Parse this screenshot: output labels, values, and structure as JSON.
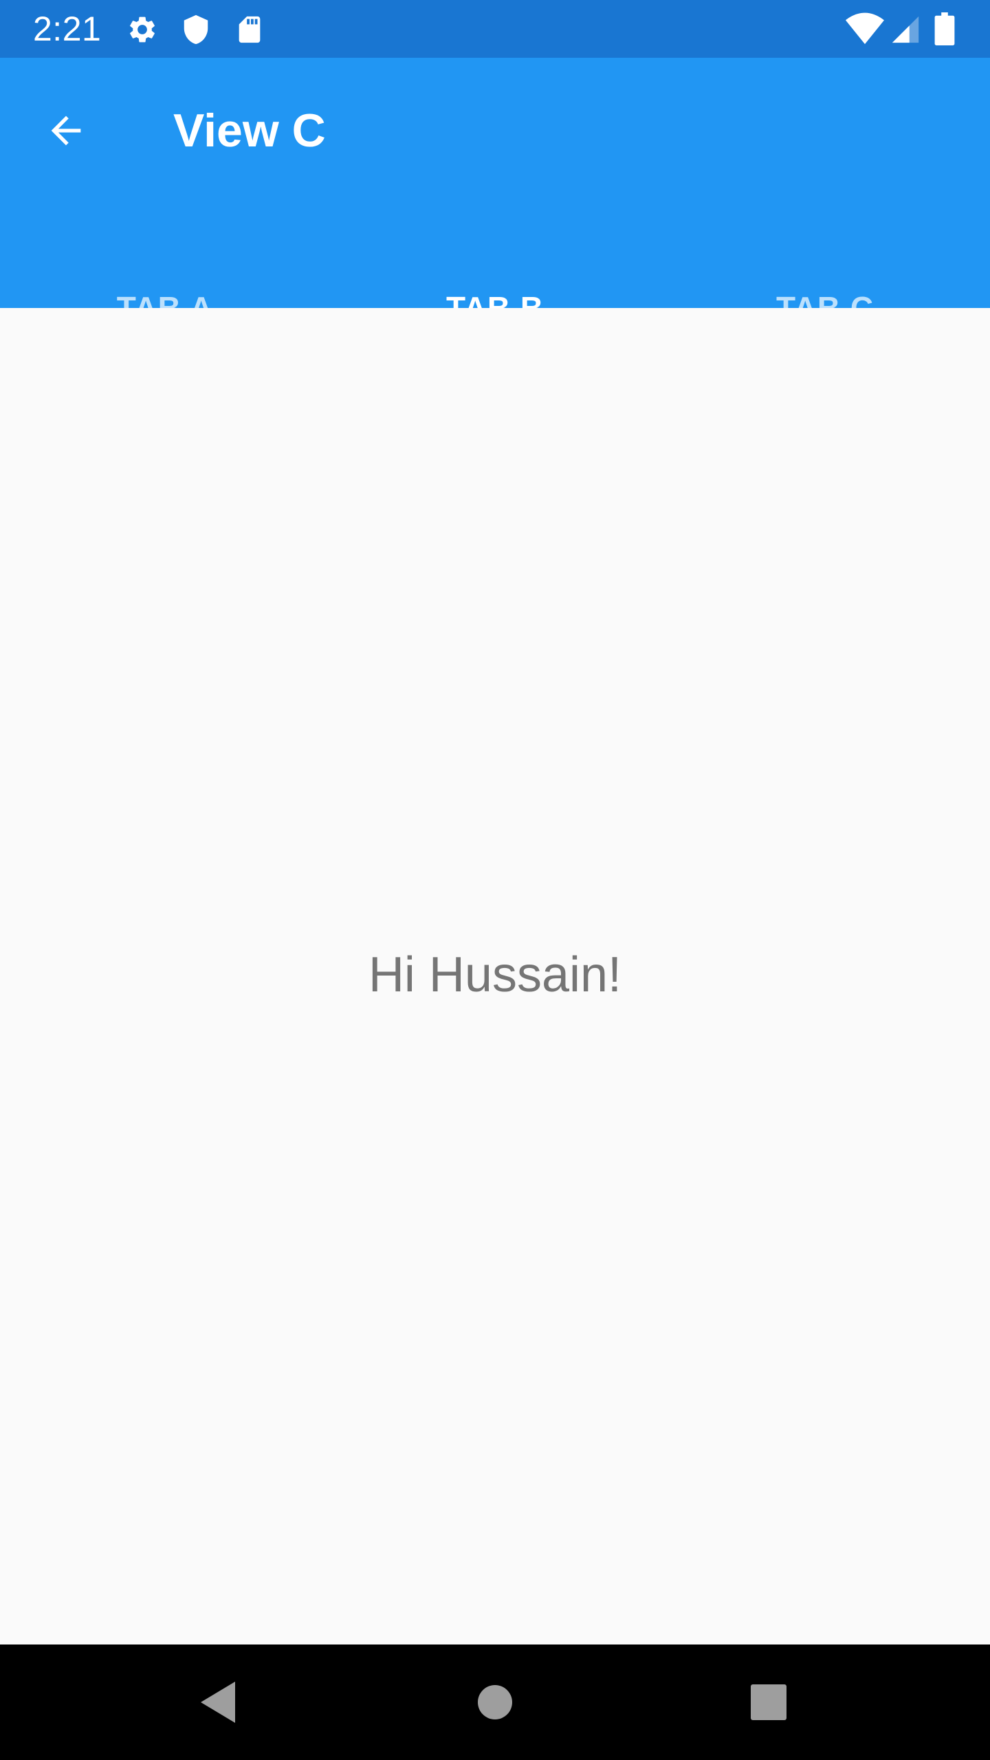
{
  "status_bar": {
    "time": "2:21",
    "left_icons": [
      "settings-icon",
      "shield-icon",
      "sd-card-icon"
    ],
    "right_icons": [
      "wifi-icon",
      "cell-signal-icon",
      "battery-icon"
    ],
    "background_color": "#1976D2"
  },
  "app_bar": {
    "title": "View C",
    "back_icon": "arrow-back-icon",
    "background_color": "#2196F3"
  },
  "tabs": [
    {
      "label": "TAB A",
      "selected": false
    },
    {
      "label": "TAB B",
      "selected": true
    },
    {
      "label": "TAB C",
      "selected": false
    }
  ],
  "content": {
    "greeting": "Hi Hussain!"
  },
  "navigation_bar": {
    "buttons": [
      "back-triangle-icon",
      "home-circle-icon",
      "recents-square-icon"
    ]
  }
}
